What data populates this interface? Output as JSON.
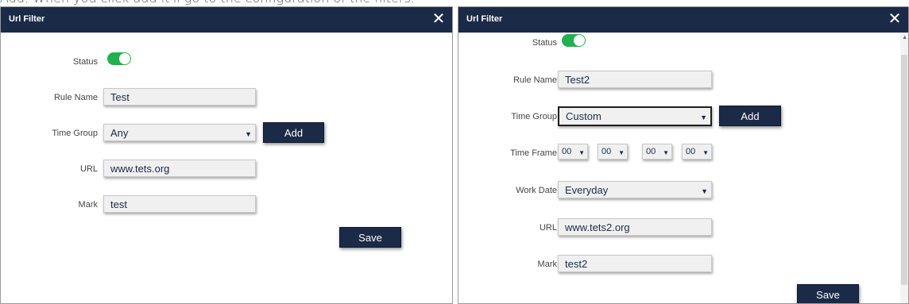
{
  "caption": "Add. When you click add it'll go to the configuration of the filters.",
  "left_dialog": {
    "title": "Url Filter",
    "close_glyph": "✕",
    "status_label": "Status",
    "status_on": true,
    "rule_name_label": "Rule Name",
    "rule_name_value": "Test",
    "time_group_label": "Time Group",
    "time_group_value": "Any",
    "add_label": "Add",
    "url_label": "URL",
    "url_value": "www.tets.org",
    "mark_label": "Mark",
    "mark_value": "test",
    "save_label": "Save"
  },
  "right_dialog": {
    "title": "Url Filter",
    "close_glyph": "✕",
    "status_label": "Status",
    "status_on": true,
    "rule_name_label": "Rule Name",
    "rule_name_value": "Test2",
    "time_group_label": "Time Group",
    "time_group_value": "Custom",
    "add_label": "Add",
    "time_frame_label": "Time Frame",
    "time_frame_values": [
      "00",
      "00",
      "00",
      "00"
    ],
    "work_date_label": "Work Date",
    "work_date_value": "Everyday",
    "url_label": "URL",
    "url_value": "www.tets2.org",
    "mark_label": "Mark",
    "mark_value": "test2",
    "save_label": "Save"
  },
  "icons": {
    "close": "close-icon",
    "caret": "chevron-down-icon",
    "scroll_up": "scroll-up-arrow-icon"
  },
  "colors": {
    "header": "#1b2a47",
    "button": "#1b2a47",
    "toggle_on": "#22b14c"
  }
}
